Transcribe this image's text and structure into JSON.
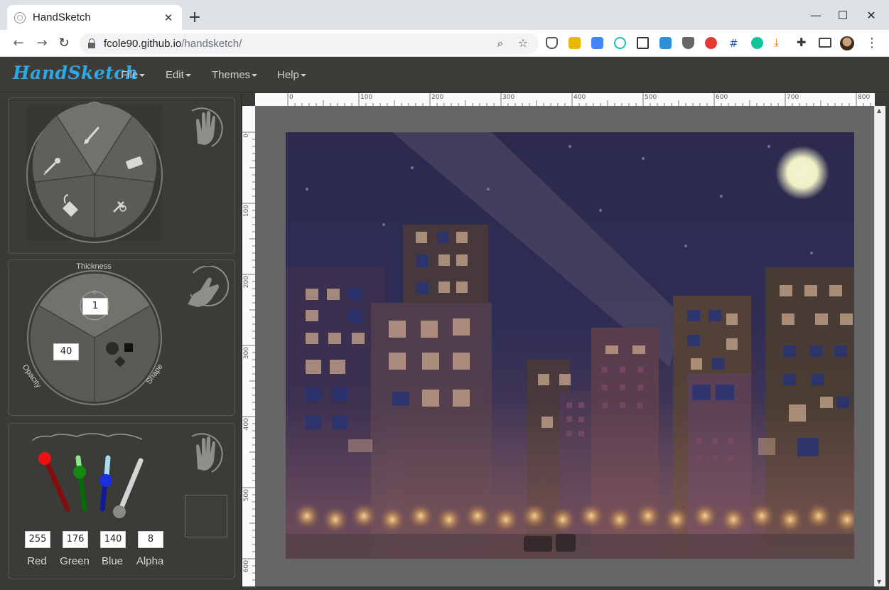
{
  "browser": {
    "tab_title": "HandSketch",
    "tab_close": "✕",
    "new_tab": "+",
    "minimize": "—",
    "maximize": "☐",
    "close": "✕",
    "back": "←",
    "forward": "→",
    "reload": "↻",
    "url_host": "fcole90.github.io",
    "url_path": "/handsketch/",
    "zoom_icon": "⌕",
    "star_icon": "☆",
    "kebab": "⋮"
  },
  "app": {
    "brand": "HandSketch",
    "menus": [
      "File",
      "Edit",
      "Themes",
      "Help"
    ]
  },
  "tools": {
    "items": [
      "brush-tool",
      "eraser-tool",
      "pen-tool",
      "bucket-tool",
      "eyedropper-tool"
    ]
  },
  "brush": {
    "thickness_label": "Thickness",
    "thickness_value": "1",
    "opacity_label": "Opacity",
    "opacity_value": "40",
    "shape_label": "Shape"
  },
  "color": {
    "red_label": "Red",
    "green_label": "Green",
    "blue_label": "Blue",
    "alpha_label": "Alpha",
    "red_value": "255",
    "green_value": "176",
    "blue_value": "140",
    "alpha_value": "8",
    "swatch_color": "#3f3d3a"
  },
  "rulers": {
    "horizontal": [
      "0",
      "100",
      "200",
      "300",
      "400",
      "500",
      "600",
      "700",
      "800"
    ],
    "vertical": [
      "0",
      "100",
      "200",
      "300",
      "400",
      "500",
      "600"
    ]
  },
  "colors": {
    "accent_brand": "#2fa9e6",
    "app_bg": "#3a3a36",
    "stage_bg": "#666666"
  }
}
